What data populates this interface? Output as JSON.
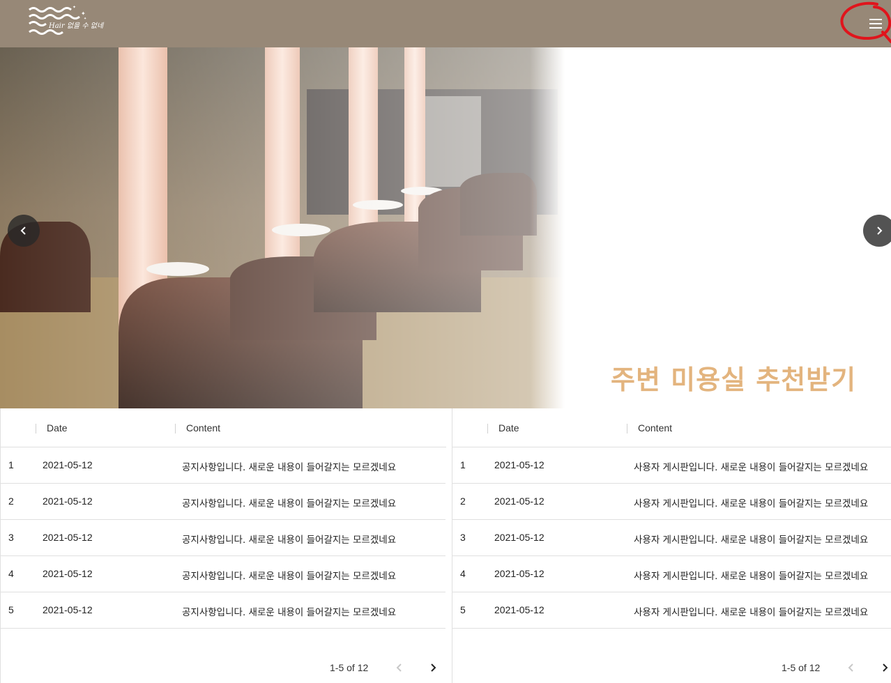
{
  "header": {
    "logo_text": "Hair 없을 수 없네",
    "menu_icon": "hamburger-menu-icon"
  },
  "colors": {
    "header_bg": "#978877",
    "caption": "#e3b47e",
    "annotation": "#e0141c"
  },
  "carousel": {
    "caption": "주변 미용실 추천받기",
    "prev_icon": "chevron-left-icon",
    "next_icon": "chevron-right-icon"
  },
  "notice_board": {
    "columns": [
      "",
      "Date",
      "Content"
    ],
    "rows": [
      {
        "no": "1",
        "date": "2021-05-12",
        "content": "공지사항입니다. 새로운 내용이 들어갈지는 모르겠네요"
      },
      {
        "no": "2",
        "date": "2021-05-12",
        "content": "공지사항입니다. 새로운 내용이 들어갈지는 모르겠네요"
      },
      {
        "no": "3",
        "date": "2021-05-12",
        "content": "공지사항입니다. 새로운 내용이 들어갈지는 모르겠네요"
      },
      {
        "no": "4",
        "date": "2021-05-12",
        "content": "공지사항입니다. 새로운 내용이 들어갈지는 모르겠네요"
      },
      {
        "no": "5",
        "date": "2021-05-12",
        "content": "공지사항입니다. 새로운 내용이 들어갈지는 모르겠네요"
      }
    ],
    "page_info": "1-5 of 12"
  },
  "user_board": {
    "columns": [
      "",
      "Date",
      "Content"
    ],
    "rows": [
      {
        "no": "1",
        "date": "2021-05-12",
        "content": "사용자 게시판입니다. 새로운 내용이 들어갈지는 모르겠네요"
      },
      {
        "no": "2",
        "date": "2021-05-12",
        "content": "사용자 게시판입니다. 새로운 내용이 들어갈지는 모르겠네요"
      },
      {
        "no": "3",
        "date": "2021-05-12",
        "content": "사용자 게시판입니다. 새로운 내용이 들어갈지는 모르겠네요"
      },
      {
        "no": "4",
        "date": "2021-05-12",
        "content": "사용자 게시판입니다. 새로운 내용이 들어갈지는 모르겠네요"
      },
      {
        "no": "5",
        "date": "2021-05-12",
        "content": "사용자 게시판입니다. 새로운 내용이 들어갈지는 모르겠네요"
      }
    ],
    "page_info": "1-5 of 12"
  }
}
